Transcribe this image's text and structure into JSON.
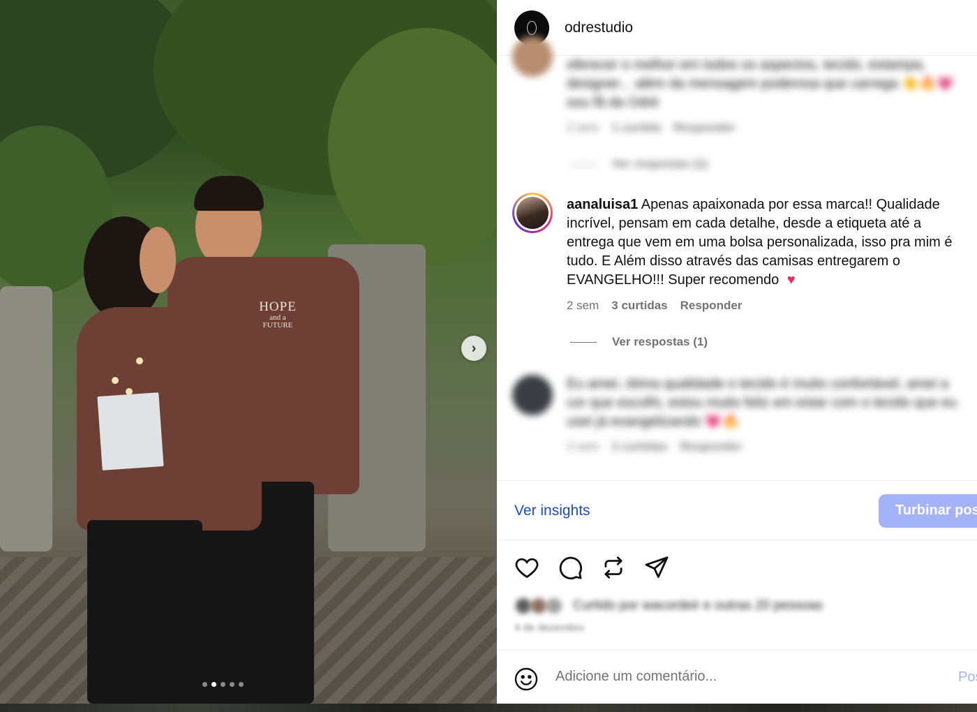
{
  "post": {
    "username": "odrestudio",
    "shirt_print": {
      "line1": "HOPE",
      "line2": "and a",
      "line3": "FUTURE"
    },
    "carousel": {
      "count": 5,
      "active_index": 1
    }
  },
  "comments": [
    {
      "username": "",
      "text": "oferecer o melhor em todos os aspectos, tecido, estampa, designer... além da mensagem poderosa que carrega 👏🔥💗 sou fã da Odré",
      "time": "2 sem",
      "likes": "1 curtida",
      "reply": "Responder",
      "view_replies": "Ver respostas (1)",
      "blurred": true
    },
    {
      "username": "aanaluisa1",
      "text": "Apenas apaixonada por essa marca!! Qualidade incrível, pensam em cada detalhe, desde a etiqueta até a entrega que vem em uma bolsa personalizada, isso pra mim é tudo. E Além disso através das camisas entregarem o EVANGELHO!!! Super recomendo",
      "emoji": "♥",
      "time": "2 sem",
      "likes": "3 curtidas",
      "reply": "Responder",
      "view_replies": "Ver respostas (1)",
      "blurred": false
    },
    {
      "username": "",
      "text": "Eu amei, ótima qualidade o tecido é muito confortável, amei a cor que escolhi, estou muito feliz em estar com o tecido que eu usei já evangelizando 💗🔥",
      "time": "2 sem",
      "likes": "3 curtidas",
      "reply": "Responder",
      "blurred": true
    }
  ],
  "insights": {
    "link": "Ver insights",
    "boost": "Turbinar post"
  },
  "actions": {
    "like_icon": "heart-icon",
    "comment_icon": "comment-icon",
    "repost_icon": "repost-icon",
    "share_icon": "send-icon"
  },
  "likes_summary": {
    "text": "Curtido por wacordeir e outras 20 pessoas",
    "blurred": true
  },
  "date": {
    "text": "4 de dezembro",
    "blurred": true
  },
  "comment_box": {
    "placeholder": "Adicione um comentário...",
    "post_label": "Postar",
    "emoji_icon": "smiley-icon"
  },
  "colors": {
    "link_blue": "#1b47c9",
    "boost_button": "#a4b3f9",
    "heart": "#ec2d5b",
    "shirt": "#6e3f35"
  }
}
